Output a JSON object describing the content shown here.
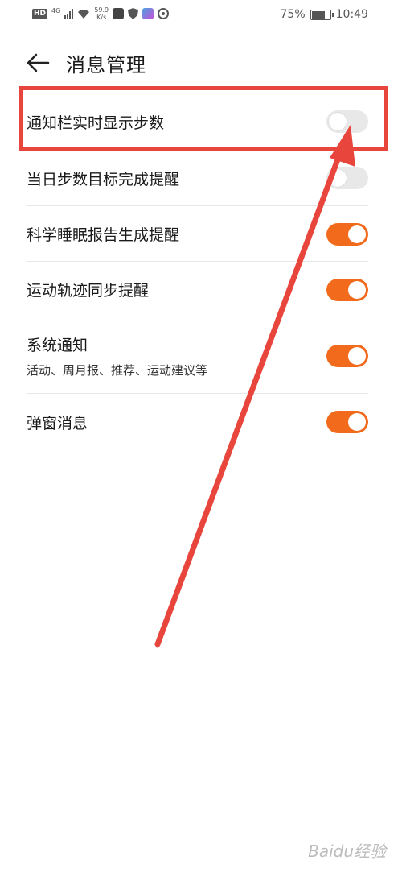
{
  "status_bar": {
    "network_badge": "HD",
    "network_type": "4G",
    "speed_value": "59.9",
    "speed_unit": "K/s",
    "battery_percent": "75%",
    "battery_level": 0.75,
    "time": "10:49"
  },
  "header": {
    "title": "消息管理"
  },
  "settings": [
    {
      "label": "通知栏实时显示步数",
      "sublabel": "",
      "enabled": false
    },
    {
      "label": "当日步数目标完成提醒",
      "sublabel": "",
      "enabled": false
    },
    {
      "label": "科学睡眠报告生成提醒",
      "sublabel": "",
      "enabled": true
    },
    {
      "label": "运动轨迹同步提醒",
      "sublabel": "",
      "enabled": true
    },
    {
      "label": "系统通知",
      "sublabel": "活动、周月报、推荐、运动建议等",
      "enabled": true
    },
    {
      "label": "弹窗消息",
      "sublabel": "",
      "enabled": true
    }
  ],
  "colors": {
    "toggle_on": "#f26b1d",
    "toggle_off": "#e8e8e8",
    "annotation": "#e8453c"
  },
  "watermark": "Baidu经验"
}
